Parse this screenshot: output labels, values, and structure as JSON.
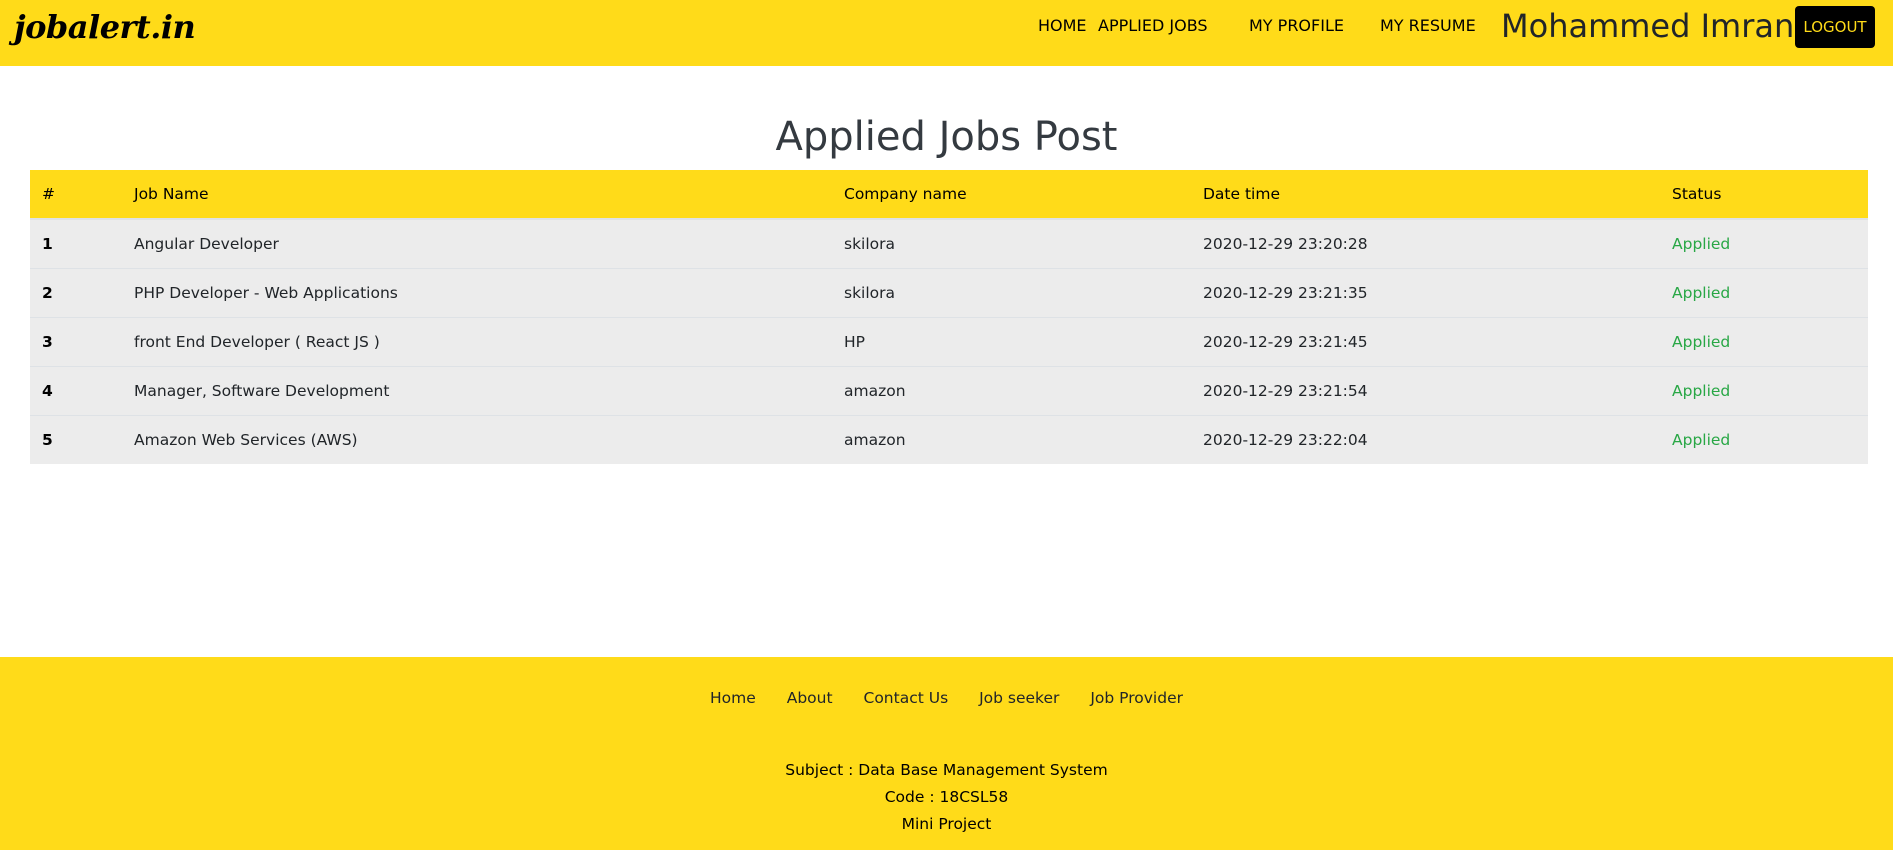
{
  "header": {
    "brand": "jobalert.in",
    "nav": {
      "home": "HOME",
      "applied_jobs": "APPLIED JOBS",
      "my_profile": "MY PROFILE",
      "my_resume": "MY RESUME"
    },
    "username": "Mohammed Imran",
    "logout_label": "LOGOUT"
  },
  "main": {
    "title": "Applied Jobs Post",
    "table": {
      "headers": [
        "#",
        "Job Name",
        "Company name",
        "Date time",
        "Status"
      ],
      "rows": [
        {
          "num": "1",
          "job": "Angular Developer",
          "company": "skilora",
          "date": "2020-12-29 23:20:28",
          "status": "Applied"
        },
        {
          "num": "2",
          "job": "PHP Developer - Web Applications",
          "company": "skilora",
          "date": "2020-12-29 23:21:35",
          "status": "Applied"
        },
        {
          "num": "3",
          "job": "front End Developer ( React JS )",
          "company": "HP",
          "date": "2020-12-29 23:21:45",
          "status": "Applied"
        },
        {
          "num": "4",
          "job": "Manager, Software Development",
          "company": "amazon",
          "date": "2020-12-29 23:21:54",
          "status": "Applied"
        },
        {
          "num": "5",
          "job": "Amazon Web Services (AWS)",
          "company": "amazon",
          "date": "2020-12-29 23:22:04",
          "status": "Applied"
        }
      ]
    }
  },
  "footer": {
    "links": [
      "Home",
      "About",
      "Contact Us",
      "Job seeker",
      "Job Provider"
    ],
    "subject": "Subject : Data Base Management System",
    "code": "Code : 18CSL58",
    "project": "Mini Project"
  },
  "colors": {
    "brand_yellow": "#ffdb19",
    "row_gray": "#ececec",
    "status_green": "#28a745",
    "logout_bg": "#000000"
  }
}
